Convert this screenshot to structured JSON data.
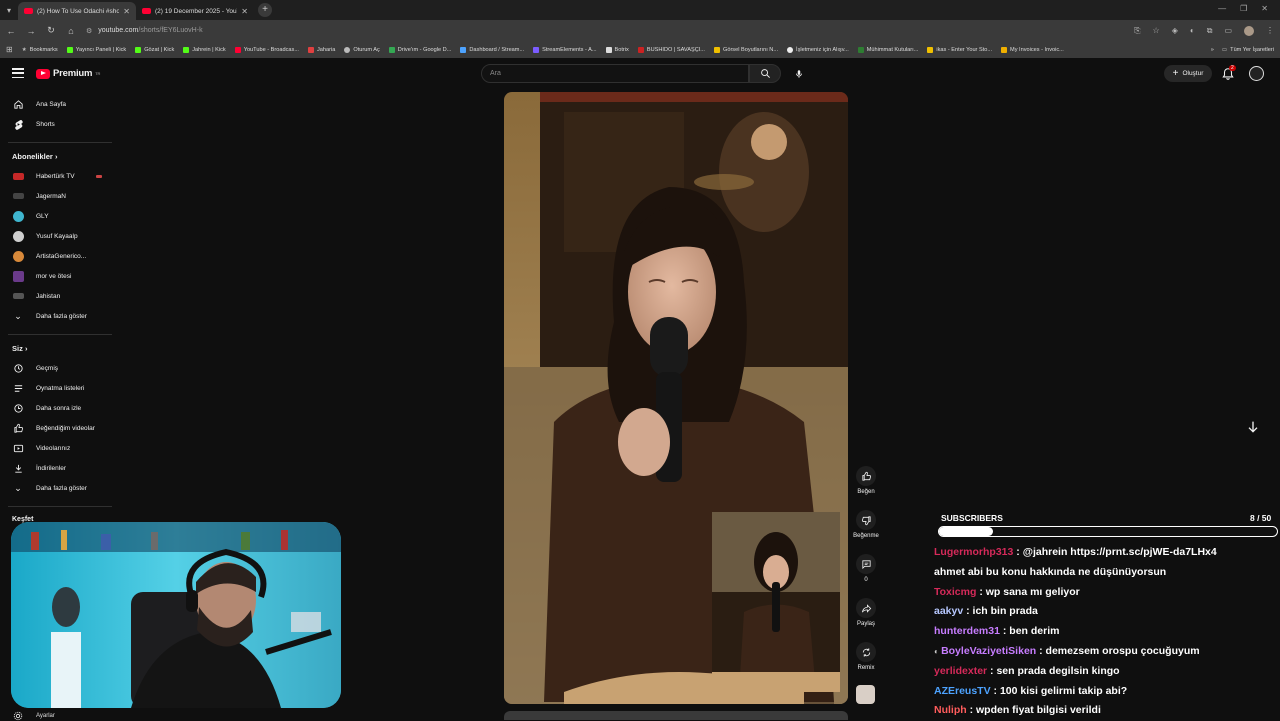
{
  "browser": {
    "tabs": [
      {
        "title": "(2) How To Use Odachi #shorts",
        "active": true
      },
      {
        "title": "(2) 19 December 2025 - YouTube",
        "active": false
      }
    ],
    "url_host": "youtube.com",
    "url_path": "/shorts/fEY6LuovH-k",
    "bookmarks": [
      {
        "label": "Bookmarks",
        "color": "#999999"
      },
      {
        "label": "Yayıncı Paneli | Kick",
        "color": "#53fc18"
      },
      {
        "label": "Gözat | Kick",
        "color": "#53fc18"
      },
      {
        "label": "Jahrein | Kick",
        "color": "#53fc18"
      },
      {
        "label": "YouTube - Broadcas...",
        "color": "#ff0033"
      },
      {
        "label": "Jaharia",
        "color": "#e04040"
      },
      {
        "label": "Oturum Aç",
        "color": "#bbbbbb"
      },
      {
        "label": "Drive'ım - Google D...",
        "color": "#34a853"
      },
      {
        "label": "Dashboard / Stream...",
        "color": "#4da3ff"
      },
      {
        "label": "StreamElements - A...",
        "color": "#7b5cff"
      },
      {
        "label": "Botrix",
        "color": "#dddddd"
      },
      {
        "label": "BUSHIDO | SAVAŞÇI...",
        "color": "#cc2222"
      },
      {
        "label": "Görsel Boyutlarını N...",
        "color": "#f0c000"
      },
      {
        "label": "İşletmeniz için Alışv...",
        "color": "#eeeeee"
      },
      {
        "label": "Mühimmat Kutuları...",
        "color": "#2e7d32"
      },
      {
        "label": "ikas - Enter Your Sto...",
        "color": "#f0c000"
      },
      {
        "label": "My Invoices - Invoic...",
        "color": "#f0b000"
      }
    ],
    "all_bookmarks_label": "Tüm Yer İşaretleri"
  },
  "header": {
    "logo_text": "Premium",
    "logo_sup": "TR",
    "search_placeholder": "Ara",
    "create_label": "Oluştur",
    "notif_count": "2"
  },
  "sidebar": {
    "top": [
      {
        "label": "Ana Sayfa",
        "icon": "home-icon"
      },
      {
        "label": "Shorts",
        "icon": "shorts-icon"
      }
    ],
    "subscriptions_title": "Abonelikler",
    "channels": [
      {
        "label": "Habertürk TV",
        "color": "#c62828",
        "live": true
      },
      {
        "label": "JagermaN",
        "color": "#444444",
        "live": false
      },
      {
        "label": "GLY",
        "color": "#3fb6cf",
        "live": false
      },
      {
        "label": "Yusuf Kayaalp",
        "color": "#cfcfcf",
        "live": false
      },
      {
        "label": "ArtistaGenerico...",
        "color": "#d8893a",
        "live": false
      },
      {
        "label": "mor ve ötesi",
        "color": "#6a3a8a",
        "live": false
      },
      {
        "label": "Jahistan",
        "color": "#555555",
        "live": false
      }
    ],
    "show_more_1": "Daha fazla göster",
    "you_title": "Siz",
    "you_items": [
      {
        "label": "Geçmiş",
        "icon": "history-icon"
      },
      {
        "label": "Oynatma listeleri",
        "icon": "playlists-icon"
      },
      {
        "label": "Daha sonra izle",
        "icon": "watch-later-icon"
      },
      {
        "label": "Beğendiğim videolar",
        "icon": "liked-icon"
      },
      {
        "label": "Videolarınız",
        "icon": "your-videos-icon"
      },
      {
        "label": "İndirilenler",
        "icon": "downloads-icon"
      }
    ],
    "show_more_2": "Daha fazla göster",
    "explore_title": "Keşfet",
    "settings_label": "Ayarlar"
  },
  "actions": {
    "like": "Beğen",
    "dislike": "Beğenme",
    "comments": "0",
    "share": "Paylaş",
    "remix": "Remix"
  },
  "goal": {
    "title": "SUBSCRIBERS",
    "current": 8,
    "total": 50,
    "count_text": "8  / 50"
  },
  "chat": [
    {
      "user": "Lugermorhp313",
      "color": "#d62a5a",
      "message": "@jahrein https://prnt.sc/pjWE-da7LHx4",
      "badge": false
    },
    {
      "user": "",
      "color": "#ffffff",
      "message": "ahmet abi bu konu hakkında ne düşünüyorsun",
      "badge": false
    },
    {
      "user": "Toxicmg",
      "color": "#d62a5a",
      "message": "wp sana mı geliyor",
      "badge": false
    },
    {
      "user": "aakyv",
      "color": "#b7c8ff",
      "message": "ich bin prada",
      "badge": false
    },
    {
      "user": "hunterdem31",
      "color": "#c77dff",
      "message": "ben derim",
      "badge": false
    },
    {
      "user": "BoyleVaziyetiSiken",
      "color": "#c77dff",
      "message": "demezsem orospu çocuğuyum",
      "badge": true
    },
    {
      "user": "yerlidexter",
      "color": "#d62a5a",
      "message": "sen prada degilsin kingo",
      "badge": false
    },
    {
      "user": "AZEreusTV",
      "color": "#4da3ff",
      "message": "100 kisi gelirmi takip abi?",
      "badge": false
    },
    {
      "user": "Nuliph",
      "color": "#ff5c5c",
      "message": "wpden fiyat bilgisi verildi",
      "badge": false
    }
  ]
}
